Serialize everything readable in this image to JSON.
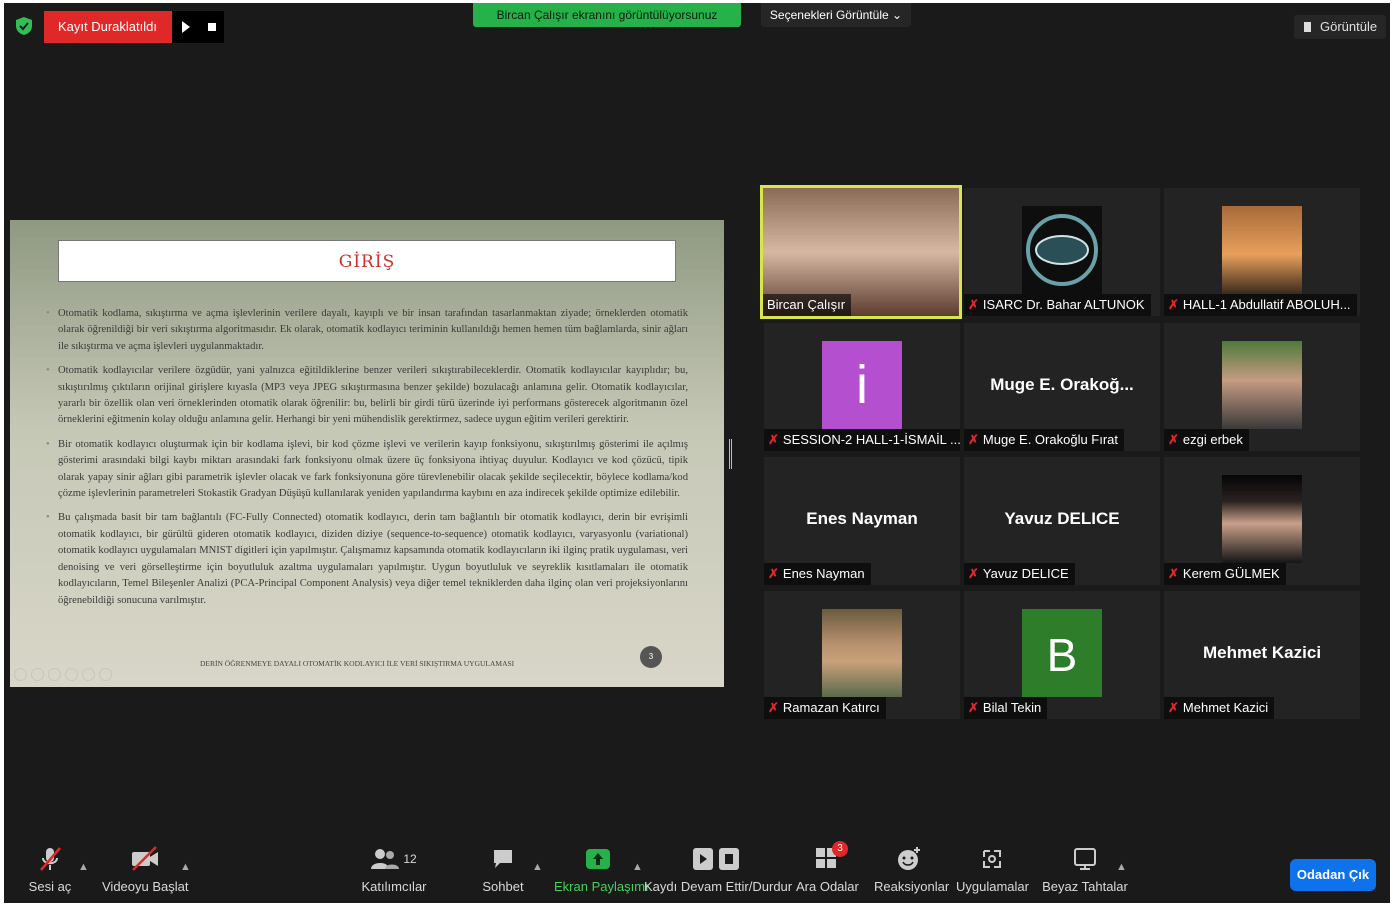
{
  "topbar": {
    "recording_status": "Kayıt Duraklatıldı",
    "share_banner": "Bircan Çalışır ekranını görüntülüyorsunuz",
    "view_options": "Seçenekleri Görüntüle",
    "view_button": "Görüntüle"
  },
  "slide": {
    "title": "GİRİŞ",
    "paragraphs": [
      "Otomatik kodlama, sıkıştırma ve açma işlevlerinin verilere dayalı, kayıplı ve bir insan tarafından tasarlanmaktan ziyade; örneklerden otomatik olarak öğrenildiği bir veri sıkıştırma algoritmasıdır. Ek olarak, otomatik kodlayıcı teriminin kullanıldığı hemen hemen tüm bağlamlarda, sinir ağları ile sıkıştırma ve açma işlevleri uygulanmaktadır.",
      "Otomatik kodlayıcılar verilere özgüdür, yani yalnızca eğitildiklerine benzer verileri sıkıştırabileceklerdir. Otomatik kodlayıcılar kayıplıdır; bu, sıkıştırılmış çıktıların orijinal girişlere kıyasla (MP3 veya JPEG sıkıştırmasına benzer şekilde) bozulacağı anlamına gelir. Otomatik kodlayıcılar, yararlı bir özellik olan veri örneklerinden otomatik olarak öğrenilir: bu, belirli bir girdi türü üzerinde iyi performans gösterecek algoritmanın özel örneklerini eğitmenin kolay olduğu anlamına gelir. Herhangi bir yeni mühendislik gerektirmez, sadece uygun eğitim verileri gerektirir.",
      "Bir otomatik kodlayıcı oluşturmak için bir kodlama işlevi, bir kod çözme işlevi ve verilerin kayıp fonksiyonu, sıkıştırılmış gösterimi ile açılmış gösterimi arasındaki bilgi kaybı miktarı arasındaki fark fonksiyonu olmak üzere üç fonksiyona ihtiyaç duyulur. Kodlayıcı ve kod çözücü, tipik olarak yapay sinir ağları gibi parametrik işlevler olacak ve fark fonksiyonuna göre türevlenebilir olacak şekilde seçilecektir, böylece kodlama/kod çözme işlevlerinin parametreleri Stokastik Gradyan Düşüşü kullanılarak yeniden yapılandırma kaybını en aza indirecek şekilde optimize edilebilir.",
      "Bu çalışmada basit bir tam bağlantılı (FC-Fully Connected) otomatik kodlayıcı, derin tam bağlantılı bir otomatik kodlayıcı, derin bir evrişimli otomatik kodlayıcı, bir gürültü gideren otomatik kodlayıcı, diziden diziye (sequence-to-sequence) otomatik kodlayıcı, varyasyonlu (variational) otomatik kodlayıcı uygulamaları MNIST digitleri için yapılmıştır. Çalışmamız kapsamında otomatik kodlayıcıların iki ilginç pratik uygulaması, veri denoising ve veri görselleştirme için boyutluluk azaltma uygulamaları yapılmıştır. Uygun boyutluluk ve seyreklik kısıtlamaları ile otomatik kodlayıcıların, Temel Bileşenler Analizi (PCA-Principal Component Analysis) veya diğer temel tekniklerden daha ilginç olan veri projeksiyonlarını öğrenebildiği sonucuna varılmıştır."
    ],
    "footer": "DERİN ÖĞRENMEYE DAYALI OTOMATİK KODLAYICI İLE VERİ SIKIŞTIRMA UYGULAMASI",
    "page_number": "3"
  },
  "participants": [
    {
      "name": "Bircan Çalışır",
      "center": "",
      "muted": false
    },
    {
      "name": "ISARC Dr. Bahar ALTUNOK",
      "center": "",
      "muted": true
    },
    {
      "name": "HALL-1 Abdullatif ABOLUH...",
      "center": "",
      "muted": true
    },
    {
      "name": "SESSION-2 HALL-1-İSMAİL ...",
      "center": "",
      "muted": true,
      "avatar_letter": "i",
      "avatar_color": "#b44fd0"
    },
    {
      "name": "Muge E. Orakoğlu Fırat",
      "center": "Muge E. Orakoğ...",
      "muted": true
    },
    {
      "name": "ezgi erbek",
      "center": "",
      "muted": true
    },
    {
      "name": "Enes Nayman",
      "center": "Enes Nayman",
      "muted": true
    },
    {
      "name": "Yavuz DELICE",
      "center": "Yavuz DELICE",
      "muted": true
    },
    {
      "name": "Kerem GÜLMEK",
      "center": "",
      "muted": true
    },
    {
      "name": "Ramazan Katırcı",
      "center": "",
      "muted": true
    },
    {
      "name": "Bilal Tekin",
      "center": "",
      "muted": true,
      "avatar_letter": "B",
      "avatar_color": "#2e7d2a"
    },
    {
      "name": "Mehmet Kazici",
      "center": "Mehmet Kazici",
      "muted": true
    }
  ],
  "toolbar": {
    "unmute": "Sesi aç",
    "start_video": "Videoyu Başlat",
    "participants": "Katılımcılar",
    "participants_count": "12",
    "chat": "Sohbet",
    "share_screen": "Ekran Paylaşımı",
    "recording": "Kaydı Devam Ettir/Durdur",
    "breakout": "Ara Odalar",
    "breakout_badge": "3",
    "reactions": "Reaksiyonlar",
    "apps": "Uygulamalar",
    "whiteboards": "Beyaz Tahtalar",
    "leave": "Odadan Çık"
  },
  "colors": {
    "recording_red": "#e02828",
    "share_green": "#27b14a",
    "active_speaker": "#d7e64d",
    "leave_blue": "#0e72ed"
  }
}
